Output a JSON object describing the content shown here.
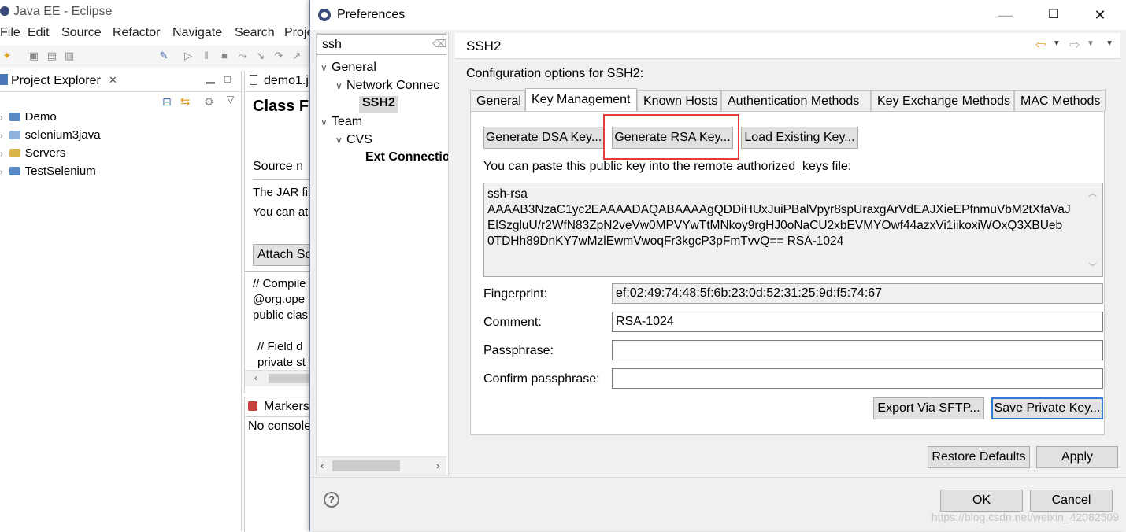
{
  "eclipse": {
    "window_title": "Java EE - Eclipse",
    "menu": [
      "File",
      "Edit",
      "Source",
      "Refactor",
      "Navigate",
      "Search",
      "Proje"
    ],
    "project_explorer": {
      "title": "Project Explorer",
      "items": [
        "Demo",
        "selenium3java",
        "Servers",
        "TestSelenium"
      ]
    },
    "editor": {
      "tab": "demo1.j",
      "heading": "Class F",
      "source_heading": "Source n",
      "line1": "The JAR fil",
      "line2": "You can at",
      "attach_button": "Attach Sc",
      "code": [
        "// Compile",
        "@org.ope",
        "public clas",
        "",
        "// Field d",
        "private st"
      ]
    },
    "markers": {
      "tab": "Markers",
      "text": "No console"
    }
  },
  "dialog": {
    "title": "Preferences",
    "filter_value": "ssh",
    "tree": {
      "general": "General",
      "network": "Network Connec",
      "ssh2": "SSH2",
      "team": "Team",
      "cvs": "CVS",
      "ext": "Ext Connectio"
    },
    "page_title": "SSH2",
    "description": "Configuration options for SSH2:",
    "tabs": [
      "General",
      "Key Management",
      "Known Hosts",
      "Authentication Methods",
      "Key Exchange Methods",
      "MAC Methods"
    ],
    "active_tab": "Key Management",
    "buttons": {
      "generate_dsa": "Generate DSA Key...",
      "generate_rsa": "Generate RSA Key...",
      "load_existing": "Load Existing Key...",
      "export_sftp": "Export Via SFTP...",
      "save_private": "Save Private Key...",
      "restore_defaults": "Restore Defaults",
      "apply": "Apply",
      "ok": "OK",
      "cancel": "Cancel"
    },
    "paste_hint": "You can paste this public key into the remote authorized_keys file:",
    "public_key": "ssh-rsa\nAAAAB3NzaC1yc2EAAAADAQABAAAAgQDDiHUxJuiPBalVpyr8spUraxgArVdEAJXieEPfnmuVbM2tXfaVaJ\nElSzgluU/r2WfN83ZpN2veVw0MPVYwTtMNkoy9rgHJ0oNaCU2xbEVMYOwf44azxVi1iikoxiWOxQ3XBUeb\n0TDHh89DnKY7wMzlEwmVwoqFr3kgcP3pFmTvvQ== RSA-1024",
    "fields": {
      "fingerprint_label": "Fingerprint:",
      "fingerprint_value": "ef:02:49:74:48:5f:6b:23:0d:52:31:25:9d:f5:74:67",
      "comment_label": "Comment:",
      "comment_value": "RSA-1024",
      "passphrase_label": "Passphrase:",
      "confirm_label": "Confirm passphrase:"
    },
    "help_icon": "?",
    "watermark": "https://blog.csdn.net/weixin_42082509",
    "colors": {
      "highlight": "#e23c3c",
      "focus": "#2f7ad6"
    }
  }
}
